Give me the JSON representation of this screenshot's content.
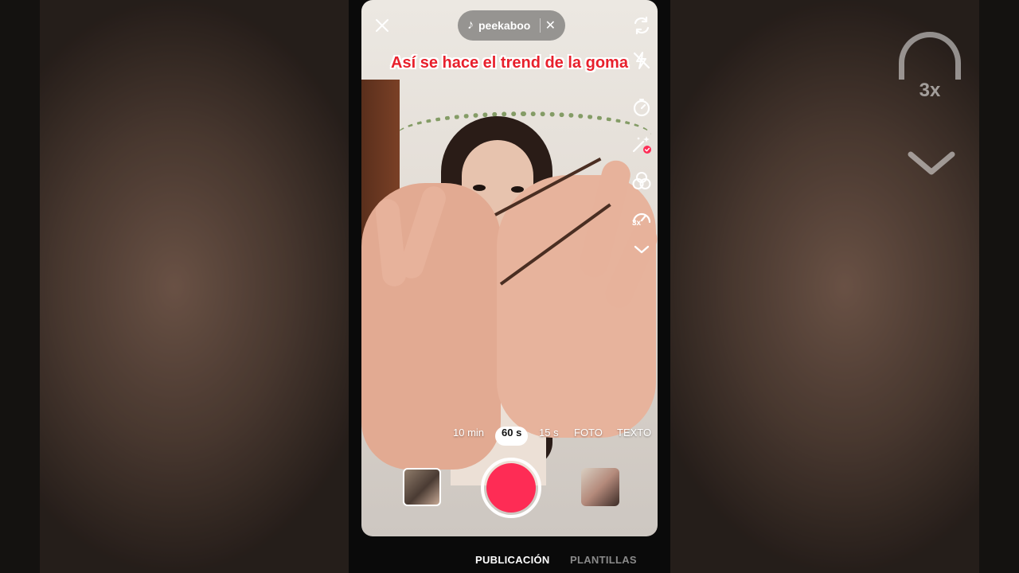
{
  "app": {
    "accent_color": "#fe2c55",
    "overlay_text_color": "#e8202c"
  },
  "top_bar": {
    "close_icon": "close-icon",
    "sound": {
      "icon": "music-note-icon",
      "name": "peekaboo",
      "remove_icon": "close-icon"
    }
  },
  "overlay": {
    "title": "Así se hace el trend de la goma"
  },
  "tools": [
    {
      "name": "flip-camera",
      "icon": "flip-camera-icon"
    },
    {
      "name": "flash-off",
      "icon": "flash-off-icon"
    },
    {
      "name": "timer",
      "icon": "timer-icon"
    },
    {
      "name": "effects",
      "icon": "sparkle-wand-icon"
    },
    {
      "name": "filters",
      "icon": "filters-icon"
    },
    {
      "name": "speed",
      "icon": "speed-gauge-icon",
      "label": "3x"
    },
    {
      "name": "more",
      "icon": "chevron-down-icon"
    }
  ],
  "modes": {
    "items": [
      "10 min",
      "60 s",
      "15 s",
      "FOTO",
      "TEXTO"
    ],
    "selected": "60 s"
  },
  "bottom_tabs": {
    "publicacion": "PUBLICACIÓN",
    "plantillas": "PLANTILLAS",
    "active": "PUBLICACIÓN"
  },
  "background": {
    "speed_label": "3x"
  }
}
